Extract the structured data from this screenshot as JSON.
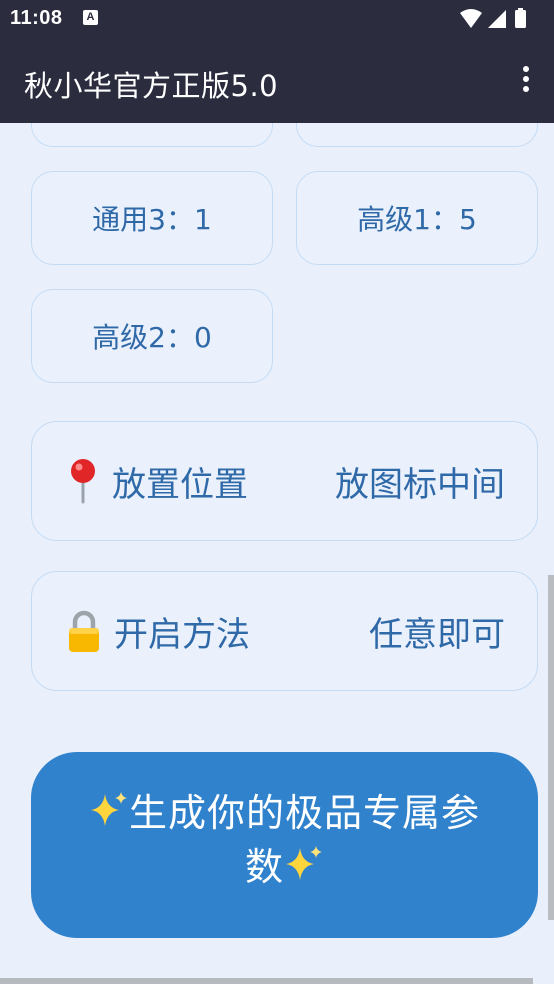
{
  "status_bar": {
    "time": "11:08",
    "notification_badge": "A",
    "icons": [
      "wifi-icon",
      "cellular-signal-icon",
      "battery-icon"
    ]
  },
  "app_bar": {
    "title": "秋小华官方正版5.0",
    "menu_icon": "more-vert-icon"
  },
  "stat_tiles": [
    {
      "label": "通用3：1"
    },
    {
      "label": "高级1：5"
    },
    {
      "label": "高级2：0"
    }
  ],
  "placement_row": {
    "icon": "pushpin-icon",
    "label": "放置位置",
    "value": "放图标中间"
  },
  "open_method_row": {
    "icon": "lock-icon",
    "label": "开启方法",
    "value": "任意即可"
  },
  "generate_button": {
    "label": "生成你的极品专属参数",
    "icon": "sparkles-icon"
  },
  "colors": {
    "app_bar_bg": "#2b2d3f",
    "page_bg": "#e9f0fb",
    "tile_border": "#c4dbf5",
    "text_blue": "#2f69a8",
    "button_blue": "#3182cc"
  }
}
